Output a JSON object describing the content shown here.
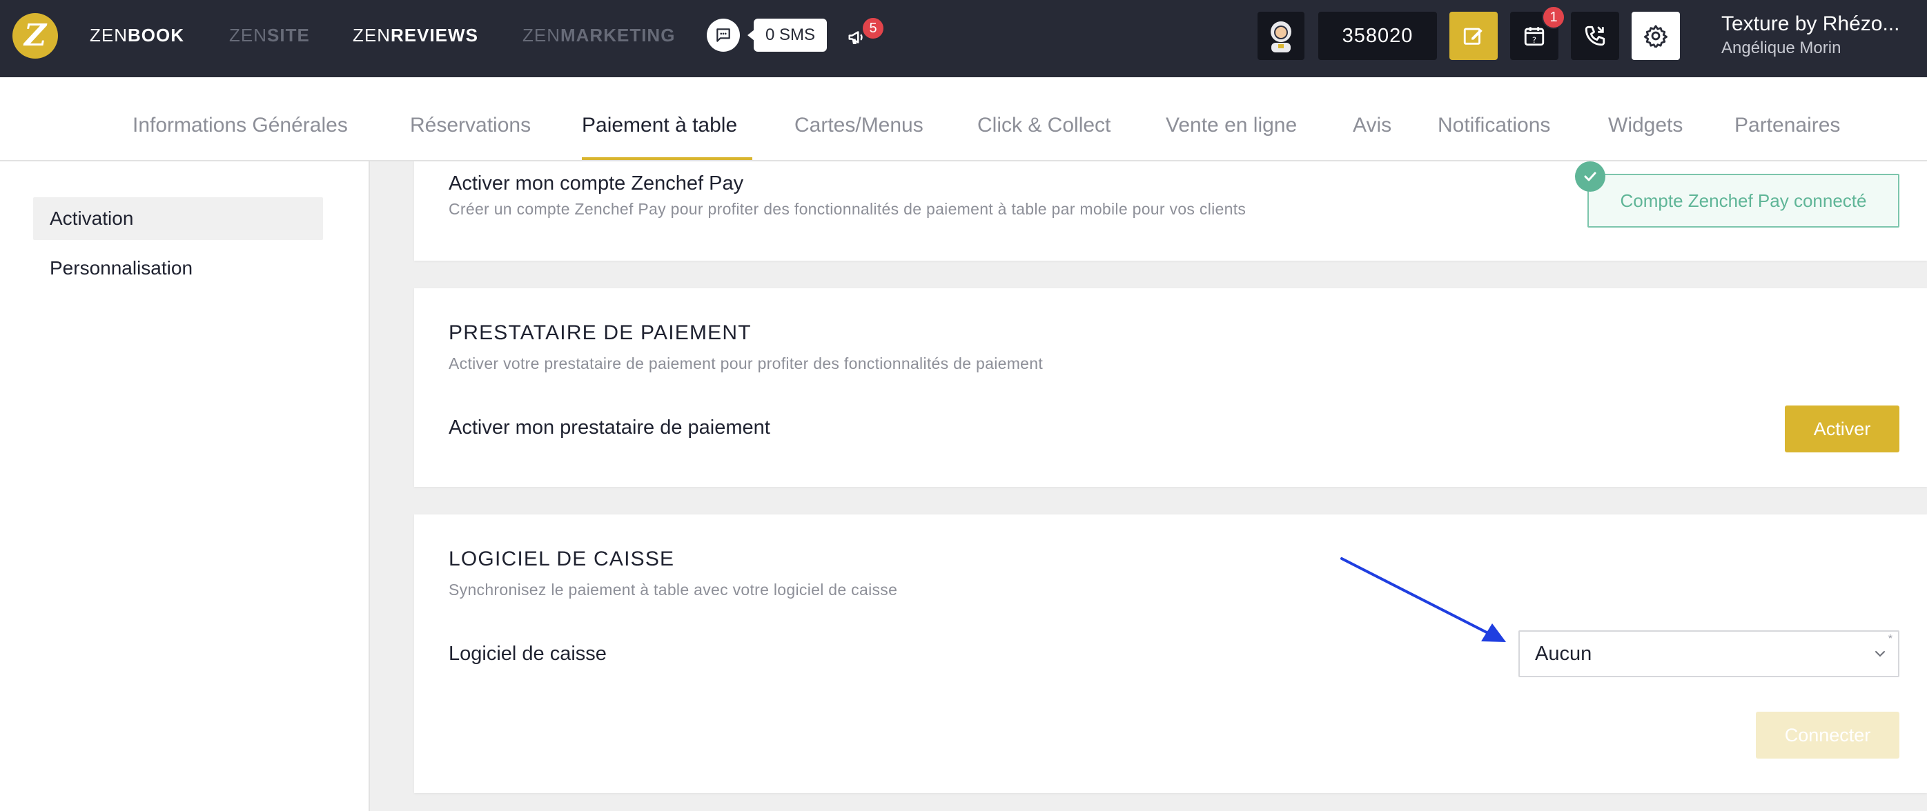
{
  "topbar": {
    "logo_letter": "Z",
    "apps": [
      {
        "prefix": "ZEN",
        "suffix": "BOOK",
        "state": "on"
      },
      {
        "prefix": "ZEN",
        "suffix": "SITE",
        "state": "off"
      },
      {
        "prefix": "ZEN",
        "suffix": "REVIEWS",
        "state": "on"
      },
      {
        "prefix": "ZEN",
        "suffix": "MARKETING",
        "state": "off"
      }
    ],
    "sms_label": "0 SMS",
    "megaphone_badge": "5",
    "account_id": "358020",
    "calendar_badge": "1",
    "restaurant_name": "Texture by Rhézo...",
    "user_name": "Angélique Morin",
    "avatar_icon": "astronaut-avatar-icon"
  },
  "tabs": [
    "Informations Générales",
    "Réservations",
    "Paiement à table",
    "Cartes/Menus",
    "Click & Collect",
    "Vente en ligne",
    "Avis",
    "Notifications",
    "Widgets",
    "Partenaires"
  ],
  "active_tab": "Paiement à table",
  "sidebar": {
    "items": [
      "Activation",
      "Personnalisation"
    ],
    "active": "Activation"
  },
  "zenchef_pay": {
    "label": "Activer mon compte Zenchef Pay",
    "description": "Créer un compte Zenchef Pay pour profiter des fonctionnalités de paiement à table par mobile pour vos clients",
    "status": "Compte Zenchef Pay connecté"
  },
  "payment_provider": {
    "title": "PRESTATAIRE DE PAIEMENT",
    "description": "Activer votre prestataire de paiement pour profiter des fonctionnalités de paiement",
    "label": "Activer mon prestataire de paiement",
    "button": "Activer"
  },
  "pos_software": {
    "title": "LOGICIEL DE CAISSE",
    "description": "Synchronisez le paiement à table avec votre logiciel de caisse",
    "label": "Logiciel de caisse",
    "selected": "Aucun",
    "required_marker": "*",
    "button": "Connecter"
  },
  "colors": {
    "brand_yellow": "#d9b52f",
    "topbar_bg": "#272a36",
    "success_green": "#5fb597",
    "badge_red": "#e2444b",
    "annotation_arrow": "#1f3ee0"
  }
}
